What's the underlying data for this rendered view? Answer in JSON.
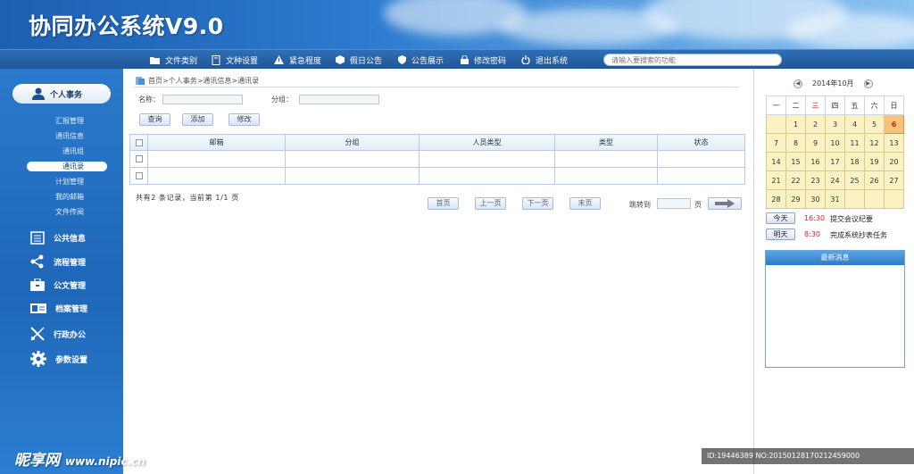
{
  "app": {
    "title": "协同办公系统V9.0"
  },
  "topnav": {
    "items": [
      {
        "label": "文件类别",
        "icon": "folder-icon"
      },
      {
        "label": "文种设置",
        "icon": "document-icon"
      },
      {
        "label": "紧急程度",
        "icon": "warning-icon"
      },
      {
        "label": "假日公告",
        "icon": "box-icon"
      },
      {
        "label": "公告展示",
        "icon": "shield-icon"
      },
      {
        "label": "修改密码",
        "icon": "lock-icon"
      },
      {
        "label": "退出系统",
        "icon": "power-icon"
      }
    ],
    "search_placeholder": "请输入要搜索的功能"
  },
  "sidebar": {
    "header": "个人事务",
    "sub_items": [
      "汇报管理",
      "通讯信息",
      "通讯组",
      "通讯录",
      "计划管理",
      "我的邮箱",
      "文件传阅"
    ],
    "active_sub": "通讯录",
    "menus": [
      {
        "label": "公共信息",
        "icon": "calendar-icon"
      },
      {
        "label": "流程管理",
        "icon": "share-icon"
      },
      {
        "label": "公文管理",
        "icon": "briefcase-icon"
      },
      {
        "label": "档案管理",
        "icon": "archive-icon"
      },
      {
        "label": "行政办公",
        "icon": "tools-icon"
      },
      {
        "label": "参数设置",
        "icon": "gear-icon"
      }
    ]
  },
  "main": {
    "breadcrumb": "首页>个人事务>通讯信息>通讯录",
    "filters": {
      "name_label": "名称：",
      "group_label": "分组：",
      "name_value": "",
      "group_value": ""
    },
    "buttons": {
      "query": "查询",
      "add": "添加",
      "edit": "修改"
    },
    "table": {
      "headers": [
        "邮箱",
        "分组",
        "人员类型",
        "类型",
        "状态"
      ],
      "rows": [
        [
          "",
          "",
          "",
          "",
          ""
        ],
        [
          "",
          "",
          "",
          "",
          ""
        ]
      ]
    },
    "pager": {
      "summary": "共有2  条记录，当前第  1/1  页",
      "first": "首页",
      "prev": "上一页",
      "next": "下一页",
      "last": "末页",
      "jump_label": "跳转到",
      "page_unit": "页",
      "jump_value": ""
    }
  },
  "calendar": {
    "month_label": "2014年10月",
    "weekdays": [
      "一",
      "二",
      "三",
      "四",
      "五",
      "六",
      "日"
    ],
    "weeks": [
      [
        "",
        "",
        "1",
        "2",
        "3",
        "4",
        "5"
      ],
      [
        "6",
        "7",
        "8",
        "9",
        "10",
        "11",
        "12"
      ],
      [
        "13",
        "14",
        "15",
        "16",
        "17",
        "18",
        "19"
      ],
      [
        "20",
        "21",
        "22",
        "23",
        "24",
        "25",
        "26"
      ],
      [
        "27",
        "28",
        "29",
        "30",
        "31",
        "",
        ""
      ]
    ],
    "display_weeks": [
      [
        "",
        "1",
        "2",
        "3",
        "4",
        "5",
        "6"
      ],
      [
        "7",
        "8",
        "9",
        "10",
        "11",
        "12",
        "13"
      ],
      [
        "14",
        "15",
        "16",
        "17",
        "18",
        "19",
        "20"
      ],
      [
        "21",
        "22",
        "23",
        "24",
        "25",
        "26",
        "27"
      ],
      [
        "28",
        "29",
        "30",
        "31",
        "",
        "",
        ""
      ]
    ],
    "today": "6"
  },
  "notes": [
    {
      "day": "今天",
      "time": "16:30",
      "text": "提交会议纪要"
    },
    {
      "day": "明天",
      "time": "8:30",
      "text": "完成系统抄表任务"
    }
  ],
  "news": {
    "title": "最新消息"
  },
  "watermark": {
    "left": "昵享网",
    "url": "www.nipic.cn",
    "right": "ID:19446389 NO:20150128170212459000"
  }
}
